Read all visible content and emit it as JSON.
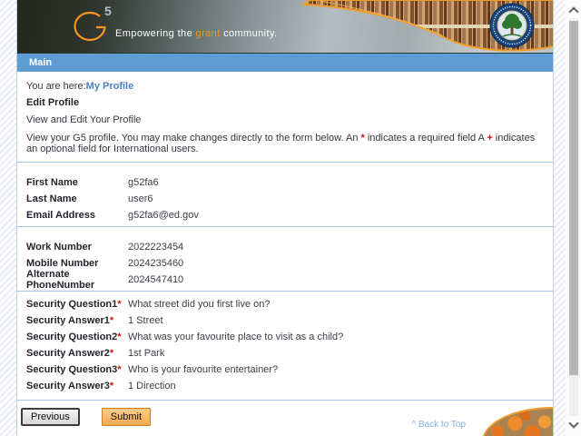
{
  "header": {
    "logo": {
      "name": "G5",
      "five": "5"
    },
    "tagline": {
      "prefix": "Empowering the ",
      "highlight": "grant",
      "suffix": " community."
    }
  },
  "nav": {
    "title": "Main"
  },
  "breadcrumb": {
    "prefix": "You are here:",
    "current": "My Profile"
  },
  "page": {
    "heading": "Edit Profile",
    "subheading": "View and Edit Your Profile",
    "instruction": {
      "part1": "View your G5 profile. You may make changes directly to the form below. An ",
      "part2": " indicates a required field A ",
      "part3": " indicates an optional field for International users."
    }
  },
  "symbols": {
    "required": "*",
    "optional": "+",
    "back_to_top_caret": "^"
  },
  "form": {
    "basic": [
      {
        "label": "First Name",
        "value": "g52fa6"
      },
      {
        "label": "Last Name",
        "value": "user6"
      },
      {
        "label": "Email Address",
        "value": "g52fa6@ed.gov"
      }
    ],
    "phone": [
      {
        "label": "Work Number",
        "value": "2022223454"
      },
      {
        "label": "Mobile Number",
        "value": "2024235460"
      },
      {
        "label": "Alternate PhoneNumber",
        "value": "2024547410"
      }
    ],
    "security": [
      {
        "label": "Security Question1",
        "value": "What street did you first live on?"
      },
      {
        "label": "Security Answer1",
        "value": "1 Street"
      },
      {
        "label": "Security Question2",
        "value": "What was your favourite place to visit as a child?"
      },
      {
        "label": "Security Answer2",
        "value": "1st Park"
      },
      {
        "label": "Security Question3",
        "value": "Who is your favourite entertainer?"
      },
      {
        "label": "Security Answer3",
        "value": "1 Direction"
      }
    ]
  },
  "buttons": {
    "previous": "Previous",
    "submit": "Submit"
  },
  "footer": {
    "back_to_top": "Back to Top"
  },
  "icons": {
    "seal": "department-of-education-seal",
    "logo": "g5-logo",
    "scroll_up": "chevron-up-icon",
    "scroll_down": "chevron-down-icon"
  },
  "colors": {
    "nav_bar_blue": "#5E9CD3",
    "accent_orange": "#F7941E",
    "required_red": "#CC1111",
    "link_blue": "#4A7FBE",
    "divider_blue": "#A9C4E7"
  }
}
